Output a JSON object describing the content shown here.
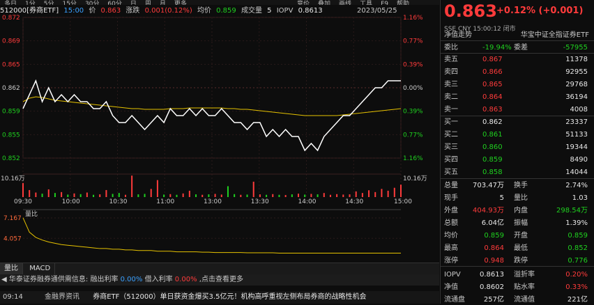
{
  "period_tabs": [
    "多日",
    "1分",
    "5分",
    "15分",
    "30分",
    "60分",
    "日",
    "周",
    "月",
    "更多"
  ],
  "top_tools": [
    "竞价",
    "叠加",
    "画线",
    "工具",
    "F9",
    "帮助"
  ],
  "info": {
    "code": "512000[券商ETF]",
    "time": "15:00",
    "price_label": "价",
    "price": "0.863",
    "change_label": "涨跌",
    "change": "0.001(0.12%)",
    "avg_label": "均价",
    "avg": "0.859",
    "vol_label": "成交量",
    "vol": "5",
    "iopv_label": "IOPV",
    "iopv": "0.8613",
    "date": "2023/05/25"
  },
  "chart_data": {
    "type": "line",
    "price_ticks": [
      "0.872",
      "0.869",
      "0.865",
      "0.862",
      "0.859",
      "0.855",
      "0.852"
    ],
    "pct_ticks": [
      "1.16%",
      "0.77%",
      "0.39%",
      "0.00%",
      "0.39%",
      "0.77%",
      "1.16%"
    ],
    "vol_tick_left": "10.16万",
    "vol_tick_right": "10.16万",
    "time_ticks": [
      "09:30",
      "10:00",
      "10:30",
      "11:00",
      "13:00",
      "13:30",
      "14:00",
      "14:30",
      "15:00"
    ],
    "ylim": [
      0.8519,
      0.8721
    ],
    "price": [
      0.859,
      0.861,
      0.863,
      0.86,
      0.862,
      0.86,
      0.861,
      0.86,
      0.861,
      0.86,
      0.86,
      0.859,
      0.859,
      0.86,
      0.858,
      0.857,
      0.857,
      0.858,
      0.857,
      0.856,
      0.857,
      0.858,
      0.857,
      0.859,
      0.858,
      0.858,
      0.859,
      0.858,
      0.859,
      0.858,
      0.858,
      0.859,
      0.858,
      0.857,
      0.857,
      0.856,
      0.857,
      0.857,
      0.855,
      0.856,
      0.855,
      0.856,
      0.855,
      0.855,
      0.853,
      0.854,
      0.853,
      0.855,
      0.856,
      0.857,
      0.858,
      0.858,
      0.859,
      0.86,
      0.861,
      0.862,
      0.862,
      0.863,
      0.863,
      0.863
    ],
    "avg": [
      0.86,
      0.8605,
      0.8607,
      0.8606,
      0.8604,
      0.8602,
      0.8601,
      0.86,
      0.8599,
      0.8598,
      0.8597,
      0.8596,
      0.8595,
      0.8594,
      0.8593,
      0.8592,
      0.8591,
      0.859,
      0.859,
      0.8589,
      0.8589,
      0.8589,
      0.8589,
      0.859,
      0.859,
      0.859,
      0.8591,
      0.8591,
      0.8591,
      0.8591,
      0.8591,
      0.8591,
      0.859,
      0.859,
      0.8589,
      0.8589,
      0.8588,
      0.8587,
      0.8586,
      0.8585,
      0.8584,
      0.8583,
      0.8582,
      0.8581,
      0.858,
      0.858,
      0.858,
      0.858,
      0.858,
      0.858,
      0.8581,
      0.8582,
      0.8583,
      0.8584,
      0.8585,
      0.8586,
      0.8587,
      0.8588,
      0.8589,
      0.859
    ],
    "volume": [
      6.2,
      3.1,
      2.0,
      1.5,
      3.4,
      1.8,
      2.2,
      1.1,
      1.6,
      1.3,
      2.0,
      1.0,
      1.2,
      3.1,
      1.4,
      1.8,
      1.0,
      9.5,
      1.2,
      1.4,
      3.6,
      7.5,
      1.1,
      1.3,
      1.0,
      1.6,
      2.8,
      1.2,
      1.0,
      1.2,
      1.4,
      1.1,
      4.8,
      1.3,
      1.0,
      1.1,
      6.8,
      1.2,
      1.0,
      1.3,
      1.0,
      0.9,
      1.2,
      1.5,
      1.1,
      1.4,
      1.2,
      1.8,
      1.0,
      1.3,
      1.1,
      1.2,
      2.5,
      1.8,
      3.0,
      2.2,
      3.6,
      2.8,
      4.1,
      5.5
    ],
    "indicator_label": "量比",
    "indicator_ticks": [
      "7.167",
      "4.057"
    ],
    "ratio": [
      7.2,
      5.0,
      4.2,
      3.8,
      3.5,
      3.3,
      3.1,
      3.0,
      2.9,
      2.8,
      2.7,
      2.6,
      2.5,
      2.5,
      2.4,
      2.4,
      2.3,
      2.3,
      2.2,
      2.2,
      2.2,
      2.1,
      2.1,
      2.1,
      2.0,
      2.0,
      2.0,
      2.0,
      1.95,
      1.95,
      1.9,
      1.9,
      1.9,
      1.9,
      1.9,
      1.85,
      1.85,
      1.85,
      1.85,
      1.85,
      1.8,
      1.8,
      1.8,
      1.8,
      1.8,
      1.8,
      1.8,
      1.8,
      1.8,
      1.8,
      1.8,
      1.8,
      1.8,
      1.8,
      1.8,
      1.8,
      1.8,
      1.8,
      1.8,
      1.8
    ]
  },
  "bottom_tabs": [
    "量比",
    "MACD"
  ],
  "news": {
    "text": "华泰证券融券通供需信息: 融出利率",
    "rate1": "0.00%",
    "mid": "借入利率",
    "rate2": "0.00%",
    "tail": ",点击查看更多"
  },
  "ticker": {
    "time": "09:14",
    "source": "金融界资讯",
    "headline": "券商ETF（512000）单日获资金爆买3.5亿元！机构高呼重视左侧布局券商的战略性机会"
  },
  "right": {
    "price": "0.863",
    "change": "+0.12% (+0.001)",
    "status": "SSE  CNY  15:00:12  闭市",
    "nav_label": "净值走势",
    "index_label": "华宝中证全指证券ETF",
    "weibi_label": "委比",
    "weibi": "-19.94%",
    "weicha_label": "委差",
    "weicha": "-57955",
    "asks": [
      {
        "label": "卖五",
        "price": "0.867",
        "vol": "11378"
      },
      {
        "label": "卖四",
        "price": "0.866",
        "vol": "92955"
      },
      {
        "label": "卖三",
        "price": "0.865",
        "vol": "29768"
      },
      {
        "label": "卖二",
        "price": "0.864",
        "vol": "36194"
      },
      {
        "label": "卖一",
        "price": "0.863",
        "vol": "4008"
      }
    ],
    "bids": [
      {
        "label": "买一",
        "price": "0.862",
        "vol": "23337"
      },
      {
        "label": "买二",
        "price": "0.861",
        "vol": "51133"
      },
      {
        "label": "买三",
        "price": "0.860",
        "vol": "19344"
      },
      {
        "label": "买四",
        "price": "0.859",
        "vol": "8490"
      },
      {
        "label": "买五",
        "price": "0.858",
        "vol": "14044"
      }
    ],
    "stats": [
      {
        "l1": "总量",
        "v1": "703.47万",
        "l2": "换手",
        "v2": "2.74%"
      },
      {
        "l1": "现手",
        "v1": "5",
        "l2": "量比",
        "v2": "1.03"
      },
      {
        "l1": "外盘",
        "v1": "404.93万",
        "l2": "内盘",
        "v2": "298.54万"
      },
      {
        "l1": "总额",
        "v1": "6.04亿",
        "l2": "振幅",
        "v2": "1.39%"
      },
      {
        "l1": "均价",
        "v1": "0.859",
        "l2": "开盘",
        "v2": "0.859"
      },
      {
        "l1": "最高",
        "v1": "0.864",
        "l2": "最低",
        "v2": "0.852"
      },
      {
        "l1": "涨停",
        "v1": "0.948",
        "l2": "跌停",
        "v2": "0.776"
      }
    ],
    "extra": [
      {
        "l1": "IOPV",
        "v1": "0.8613",
        "l2": "溢折率",
        "v2": "0.20%"
      },
      {
        "l1": "净值",
        "v1": "0.8602",
        "l2": "贴水率",
        "v2": "0.33%"
      },
      {
        "l1": "流通盘",
        "v1": "257亿",
        "l2": "流通值",
        "v2": "221亿"
      }
    ]
  },
  "colors": {
    "up": "#ff3b3b",
    "down": "#1fd11f",
    "avg_line": "#e6c200",
    "price_line": "#ffffff"
  }
}
